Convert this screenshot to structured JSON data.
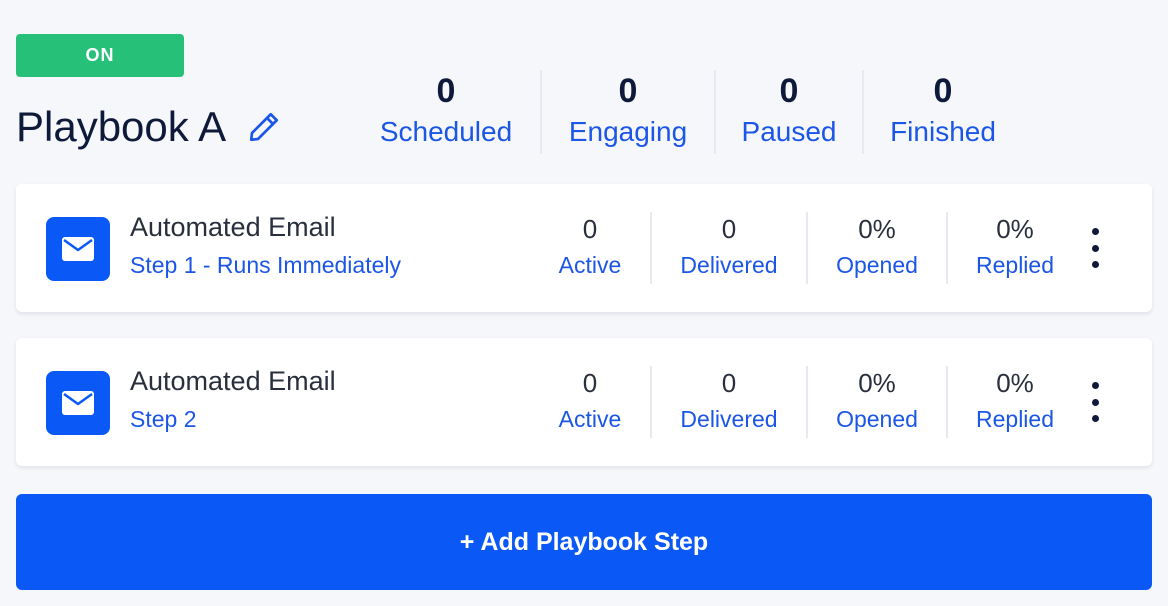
{
  "status": {
    "label": "ON",
    "color": "#27c079"
  },
  "playbook": {
    "title": "Playbook A",
    "edit_icon": "pencil-icon"
  },
  "summary": [
    {
      "value": "0",
      "label": "Scheduled"
    },
    {
      "value": "0",
      "label": "Engaging"
    },
    {
      "value": "0",
      "label": "Paused"
    },
    {
      "value": "0",
      "label": "Finished"
    }
  ],
  "steps": [
    {
      "icon": "envelope-icon",
      "title": "Automated Email",
      "subtitle": "Step 1 - Runs Immediately",
      "metrics": [
        {
          "value": "0",
          "label": "Active"
        },
        {
          "value": "0",
          "label": "Delivered"
        },
        {
          "value": "0%",
          "label": "Opened"
        },
        {
          "value": "0%",
          "label": "Replied"
        }
      ],
      "menu_icon": "kebab-menu-icon"
    },
    {
      "icon": "envelope-icon",
      "title": "Automated Email",
      "subtitle": "Step 2",
      "metrics": [
        {
          "value": "0",
          "label": "Active"
        },
        {
          "value": "0",
          "label": "Delivered"
        },
        {
          "value": "0%",
          "label": "Opened"
        },
        {
          "value": "0%",
          "label": "Replied"
        }
      ],
      "menu_icon": "kebab-menu-icon"
    }
  ],
  "add_step": {
    "label": "+ Add Playbook Step"
  },
  "colors": {
    "accent": "#0a58f6",
    "link": "#1c56e6",
    "heading": "#0f1a3a",
    "background": "#f6f7fb"
  }
}
